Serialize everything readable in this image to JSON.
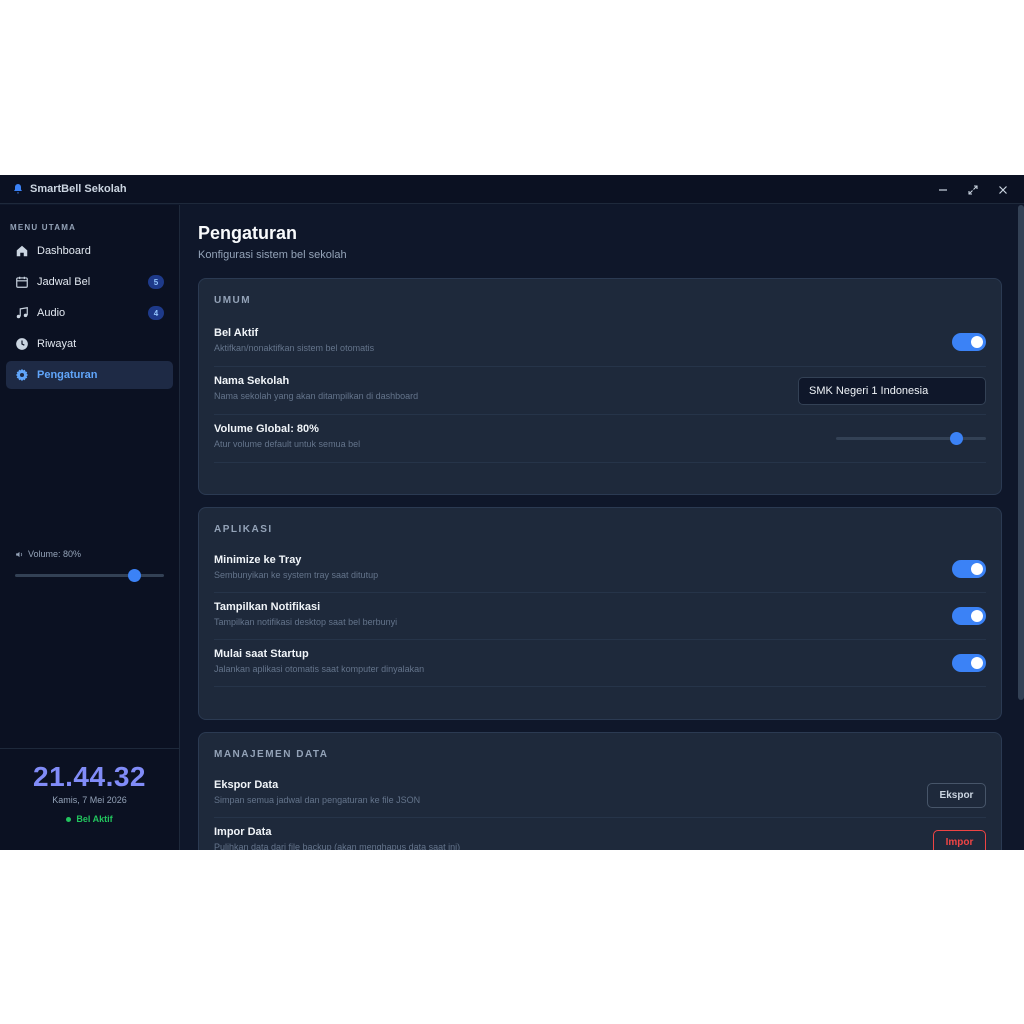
{
  "app": {
    "title": "SmartBell Sekolah",
    "icon": "bell-icon"
  },
  "colors": {
    "accent": "#3b82f6",
    "clock": "#818cf8",
    "success": "#22c55e",
    "danger": "#ef4444"
  },
  "sidebar": {
    "heading": "MENU UTAMA",
    "items": [
      {
        "label": "Dashboard",
        "icon": "home-icon",
        "badge": null,
        "active": false
      },
      {
        "label": "Jadwal Bel",
        "icon": "calendar-icon",
        "badge": "5",
        "active": false
      },
      {
        "label": "Audio",
        "icon": "music-note-icon",
        "badge": "4",
        "active": false
      },
      {
        "label": "Riwayat",
        "icon": "clock-icon",
        "badge": null,
        "active": false
      },
      {
        "label": "Pengaturan",
        "icon": "gear-icon",
        "badge": null,
        "active": true
      }
    ],
    "volume": {
      "label": "Volume: 80%",
      "value": 80
    },
    "clock": {
      "time": "21.44.32",
      "date": "Kamis, 7 Mei 2026",
      "status": "Bel Aktif"
    }
  },
  "main": {
    "title": "Pengaturan",
    "subtitle": "Konfigurasi sistem bel sekolah",
    "general": {
      "heading": "UMUM",
      "bell_active": {
        "title": "Bel Aktif",
        "desc": "Aktifkan/nonaktifkan sistem bel otomatis",
        "on": true
      },
      "school_name": {
        "title": "Nama Sekolah",
        "desc": "Nama sekolah yang akan ditampilkan di dashboard",
        "value": "SMK Negeri 1 Indonesia"
      },
      "global_volume": {
        "title": "Volume Global: 80%",
        "desc": "Atur volume default untuk semua bel",
        "value": 80
      }
    },
    "application": {
      "heading": "APLIKASI",
      "tray": {
        "title": "Minimize ke Tray",
        "desc": "Sembunyikan ke system tray saat ditutup",
        "on": true
      },
      "notify": {
        "title": "Tampilkan Notifikasi",
        "desc": "Tampilkan notifikasi desktop saat bel berbunyi",
        "on": true
      },
      "startup": {
        "title": "Mulai saat Startup",
        "desc": "Jalankan aplikasi otomatis saat komputer dinyalakan",
        "on": true
      }
    },
    "data": {
      "heading": "MANAJEMEN DATA",
      "export": {
        "title": "Ekspor Data",
        "desc": "Simpan semua jadwal dan pengaturan ke file JSON",
        "button": "Ekspor"
      },
      "import": {
        "title": "Impor Data",
        "desc": "Pulihkan data dari file backup (akan menghapus data saat ini)",
        "button": "Impor"
      }
    }
  }
}
